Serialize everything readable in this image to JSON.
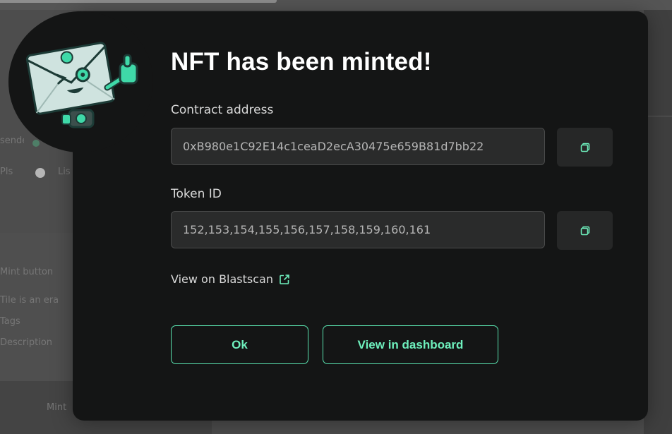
{
  "background": {
    "texts": [
      "sender",
      "Pls",
      "Lis",
      "Mint button",
      "Tile is an era",
      "Tags",
      "Description",
      "Mint"
    ]
  },
  "modal": {
    "title": "NFT has been minted!",
    "contract": {
      "label": "Contract address",
      "value": "0xB980e1C92E14c1ceaD2ecA30475e659B81d7bb22",
      "copy_icon": "copy-icon"
    },
    "token": {
      "label": "Token ID",
      "value": "152,153,154,155,156,157,158,159,160,161",
      "copy_icon": "copy-icon"
    },
    "explorer_link": {
      "label": "View on Blastscan",
      "icon": "external-link-icon"
    },
    "buttons": {
      "ok": "Ok",
      "dashboard": "View in dashboard"
    },
    "mascot_icon": "envelope-robot-mascot"
  },
  "colors": {
    "modal_bg": "#141515",
    "accent": "#6ef0bd",
    "input_bg": "#2a2b2b",
    "text_primary": "#ffffff",
    "text_secondary": "#d9d9d9"
  }
}
